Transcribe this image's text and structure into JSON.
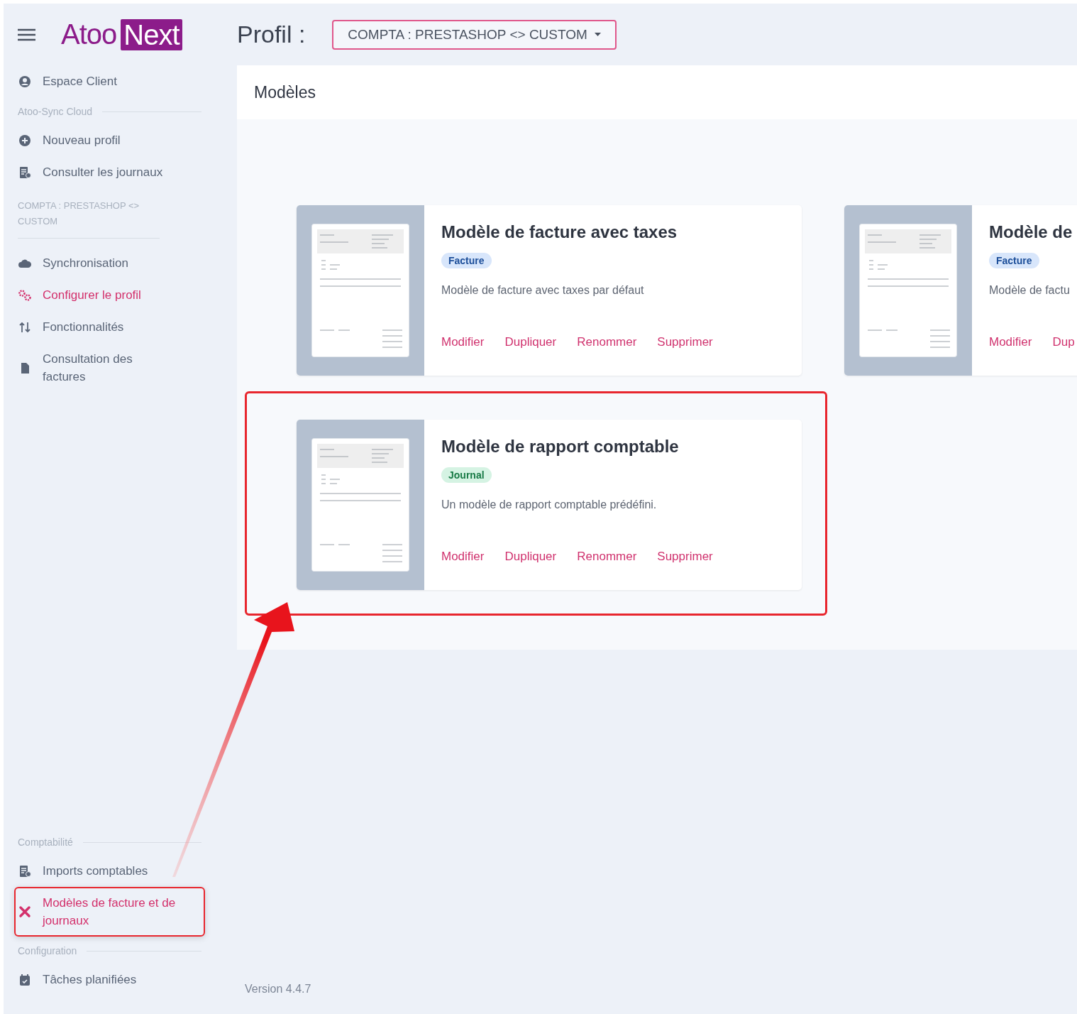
{
  "header": {
    "logo": {
      "part_1": "Atoo",
      "part_2": "Next"
    },
    "profile_label": "Profil :",
    "profile_select": "COMPTA : PRESTASHOP <> CUSTOM"
  },
  "sidebar": {
    "sections": [
      {
        "kind": "plain",
        "items": [
          {
            "kind": "user",
            "label": "Espace Client",
            "selected": false,
            "highlighted": false
          }
        ]
      },
      {
        "kind": "group",
        "heading": "Atoo-Sync Cloud",
        "items": [
          {
            "kind": "plus",
            "label": "Nouveau profil",
            "selected": false,
            "highlighted": false
          },
          {
            "kind": "sheet",
            "label": "Consulter les journaux",
            "selected": false,
            "highlighted": false
          }
        ]
      },
      {
        "kind": "profile",
        "heading": "COMPTA : PRESTASHOP <> CUSTOM",
        "items": [
          {
            "kind": "cloud",
            "label": "Synchronisation",
            "selected": false,
            "highlighted": false
          },
          {
            "kind": "gears",
            "label": "Configurer le profil",
            "selected": true,
            "highlighted": false
          },
          {
            "kind": "updown",
            "label": "Fonctionnalités",
            "selected": false,
            "highlighted": false
          },
          {
            "kind": "file",
            "label": "Consultation des factures",
            "selected": false,
            "highlighted": false
          }
        ]
      },
      {
        "kind": "group",
        "heading": "Comptabilité",
        "items": [
          {
            "kind": "sheet",
            "label": "Imports comptables",
            "selected": false,
            "highlighted": false
          },
          {
            "kind": "tools",
            "label": "Modèles de facture et de journaux",
            "selected": true,
            "highlighted": true
          }
        ]
      },
      {
        "kind": "group",
        "heading": "Configuration",
        "items": [
          {
            "kind": "calendar",
            "label": "Tâches planifiées",
            "selected": false,
            "highlighted": false
          }
        ]
      }
    ]
  },
  "panel": {
    "title": "Modèles",
    "cards": [
      {
        "title": "Modèle de facture avec taxes",
        "tag": {
          "label": "Facture",
          "kind": "invoice"
        },
        "description": "Modèle de facture avec taxes par défaut",
        "actions": [
          "Modifier",
          "Dupliquer",
          "Renommer",
          "Supprimer"
        ]
      },
      {
        "title": "Modèle de",
        "tag": {
          "label": "Facture",
          "kind": "invoice"
        },
        "description": "Modèle de factu",
        "actions": [
          "Modifier",
          "Dup"
        ]
      },
      {
        "title": "Modèle de rapport comptable",
        "tag": {
          "label": "Journal",
          "kind": "journal"
        },
        "description": "Un modèle de rapport comptable prédéfini.",
        "actions": [
          "Modifier",
          "Dupliquer",
          "Renommer",
          "Supprimer"
        ],
        "highlighted": true
      }
    ]
  },
  "footer": {
    "version": "Version 4.4.7"
  }
}
